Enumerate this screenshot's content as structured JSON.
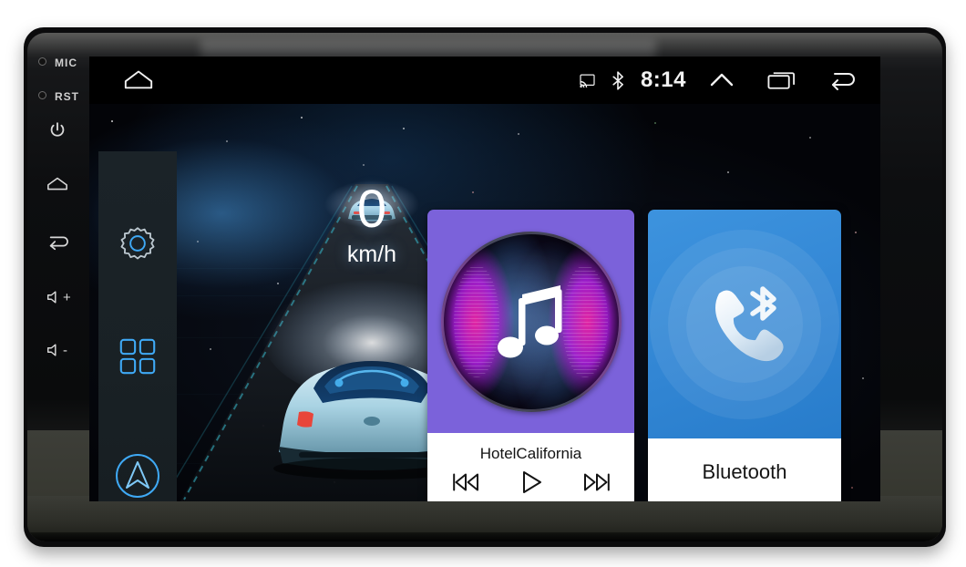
{
  "device": {
    "hardware_buttons": [
      {
        "name": "mic",
        "label": "MIC",
        "type": "pinhole"
      },
      {
        "name": "reset",
        "label": "RST",
        "type": "pinhole"
      },
      {
        "name": "power",
        "label": "",
        "icon": "power-icon"
      },
      {
        "name": "home",
        "label": "",
        "icon": "home-icon"
      },
      {
        "name": "back",
        "label": "",
        "icon": "back-arrow-icon"
      },
      {
        "name": "volume-up",
        "label": "+",
        "icon": "speaker-plus-icon"
      },
      {
        "name": "volume-down",
        "label": "-",
        "icon": "speaker-minus-icon"
      }
    ]
  },
  "statusbar": {
    "home_icon": "home-icon",
    "clock": "8:14",
    "icons": [
      "cast-icon",
      "bluetooth-icon",
      "chevron-up-icon",
      "recents-icon",
      "back-arrow-icon"
    ]
  },
  "sidebar": {
    "items": [
      {
        "name": "settings",
        "icon": "gear-icon"
      },
      {
        "name": "apps",
        "icon": "apps-grid-icon"
      },
      {
        "name": "navigation",
        "icon": "navigation-arrow-icon"
      }
    ]
  },
  "dashboard": {
    "speed_value": "0",
    "speed_unit": "km/h",
    "wallpaper": "futuristic-car-on-road"
  },
  "widgets": {
    "music": {
      "title": "HotelCalifornia",
      "accent_color": "#7b62da",
      "album_art": "music-note-waveform",
      "controls": [
        {
          "name": "previous",
          "icon": "previous-track-icon"
        },
        {
          "name": "play",
          "icon": "play-icon"
        },
        {
          "name": "next",
          "icon": "next-track-icon"
        }
      ]
    },
    "bluetooth": {
      "label": "Bluetooth",
      "accent_color": "#3286d4",
      "icon": "bluetooth-phone-icon"
    }
  },
  "pager": {
    "dots": [
      {
        "active": true
      },
      {
        "active": false
      }
    ]
  }
}
